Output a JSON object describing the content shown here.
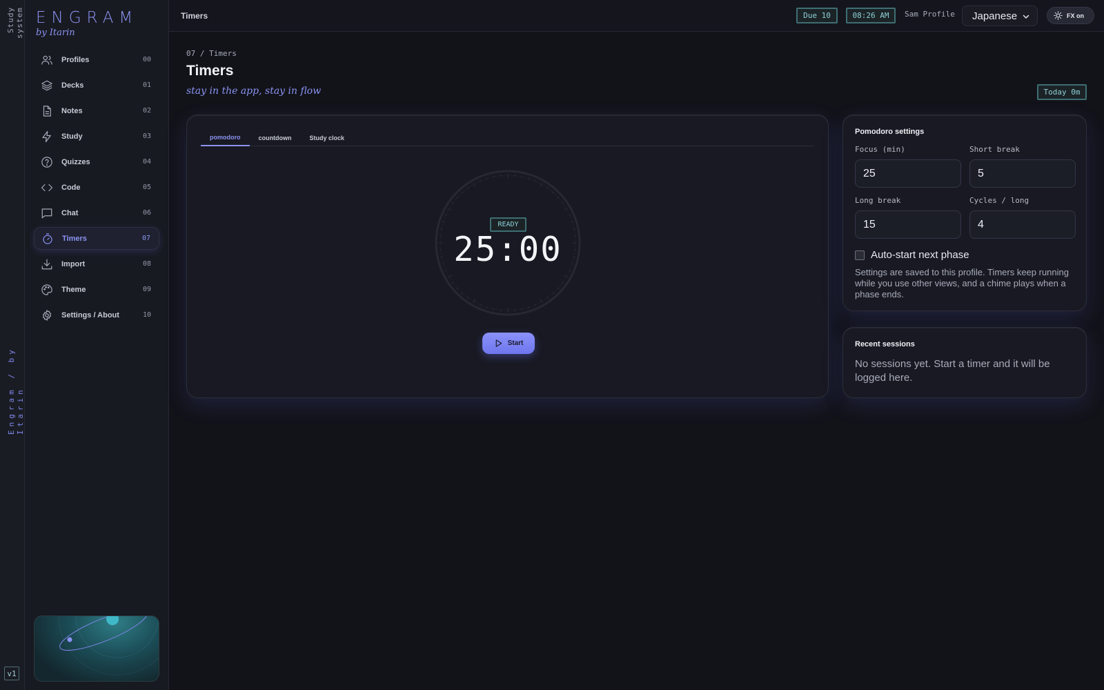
{
  "rail": {
    "top_label": "Study system",
    "brand_label": "Engram / by Itarin",
    "version": "v1"
  },
  "sidebar": {
    "logo": "ENGRAM",
    "logo_sub": "by Itarin",
    "items": [
      {
        "label": "Profiles",
        "num": "00",
        "icon": "users-icon"
      },
      {
        "label": "Decks",
        "num": "01",
        "icon": "layers-icon"
      },
      {
        "label": "Notes",
        "num": "02",
        "icon": "file-text-icon"
      },
      {
        "label": "Study",
        "num": "03",
        "icon": "bolt-icon"
      },
      {
        "label": "Quizzes",
        "num": "04",
        "icon": "help-circle-icon"
      },
      {
        "label": "Code",
        "num": "05",
        "icon": "code-icon"
      },
      {
        "label": "Chat",
        "num": "06",
        "icon": "chat-icon"
      },
      {
        "label": "Timers",
        "num": "07",
        "icon": "timer-icon",
        "active": true
      },
      {
        "label": "Import",
        "num": "08",
        "icon": "download-icon"
      },
      {
        "label": "Theme",
        "num": "09",
        "icon": "palette-icon"
      },
      {
        "label": "Settings / About",
        "num": "10",
        "icon": "gear-icon"
      }
    ]
  },
  "topbar": {
    "title": "Timers",
    "due": "Due 10",
    "time": "08:26 AM",
    "profile": "Sam Profile",
    "language": "Japanese",
    "fx": "FX on"
  },
  "page": {
    "breadcrumb": "07 / Timers",
    "title": "Timers",
    "tagline": "stay in the app, stay in flow",
    "today": "Today 0m"
  },
  "timer": {
    "tabs": [
      "pomodoro",
      "countdown",
      "Study clock"
    ],
    "active_tab": "pomodoro",
    "status": "READY",
    "display": "25:00",
    "start_label": "Start"
  },
  "settings": {
    "heading": "Pomodoro settings",
    "focus_label": "Focus (min)",
    "focus_value": "25",
    "short_label": "Short break",
    "short_value": "5",
    "long_label": "Long break",
    "long_value": "15",
    "cycles_label": "Cycles / long",
    "cycles_value": "4",
    "autostart_label": "Auto-start next phase",
    "autostart_checked": false,
    "note": "Settings are saved to this profile. Timers keep running while you use other views, and a chime plays when a phase ends."
  },
  "sessions": {
    "heading": "Recent sessions",
    "empty": "No sessions yet. Start a timer and it will be logged here."
  },
  "colors": {
    "accent": "#8b93f2",
    "teal": "#8fd0d5",
    "background": "#121319"
  }
}
